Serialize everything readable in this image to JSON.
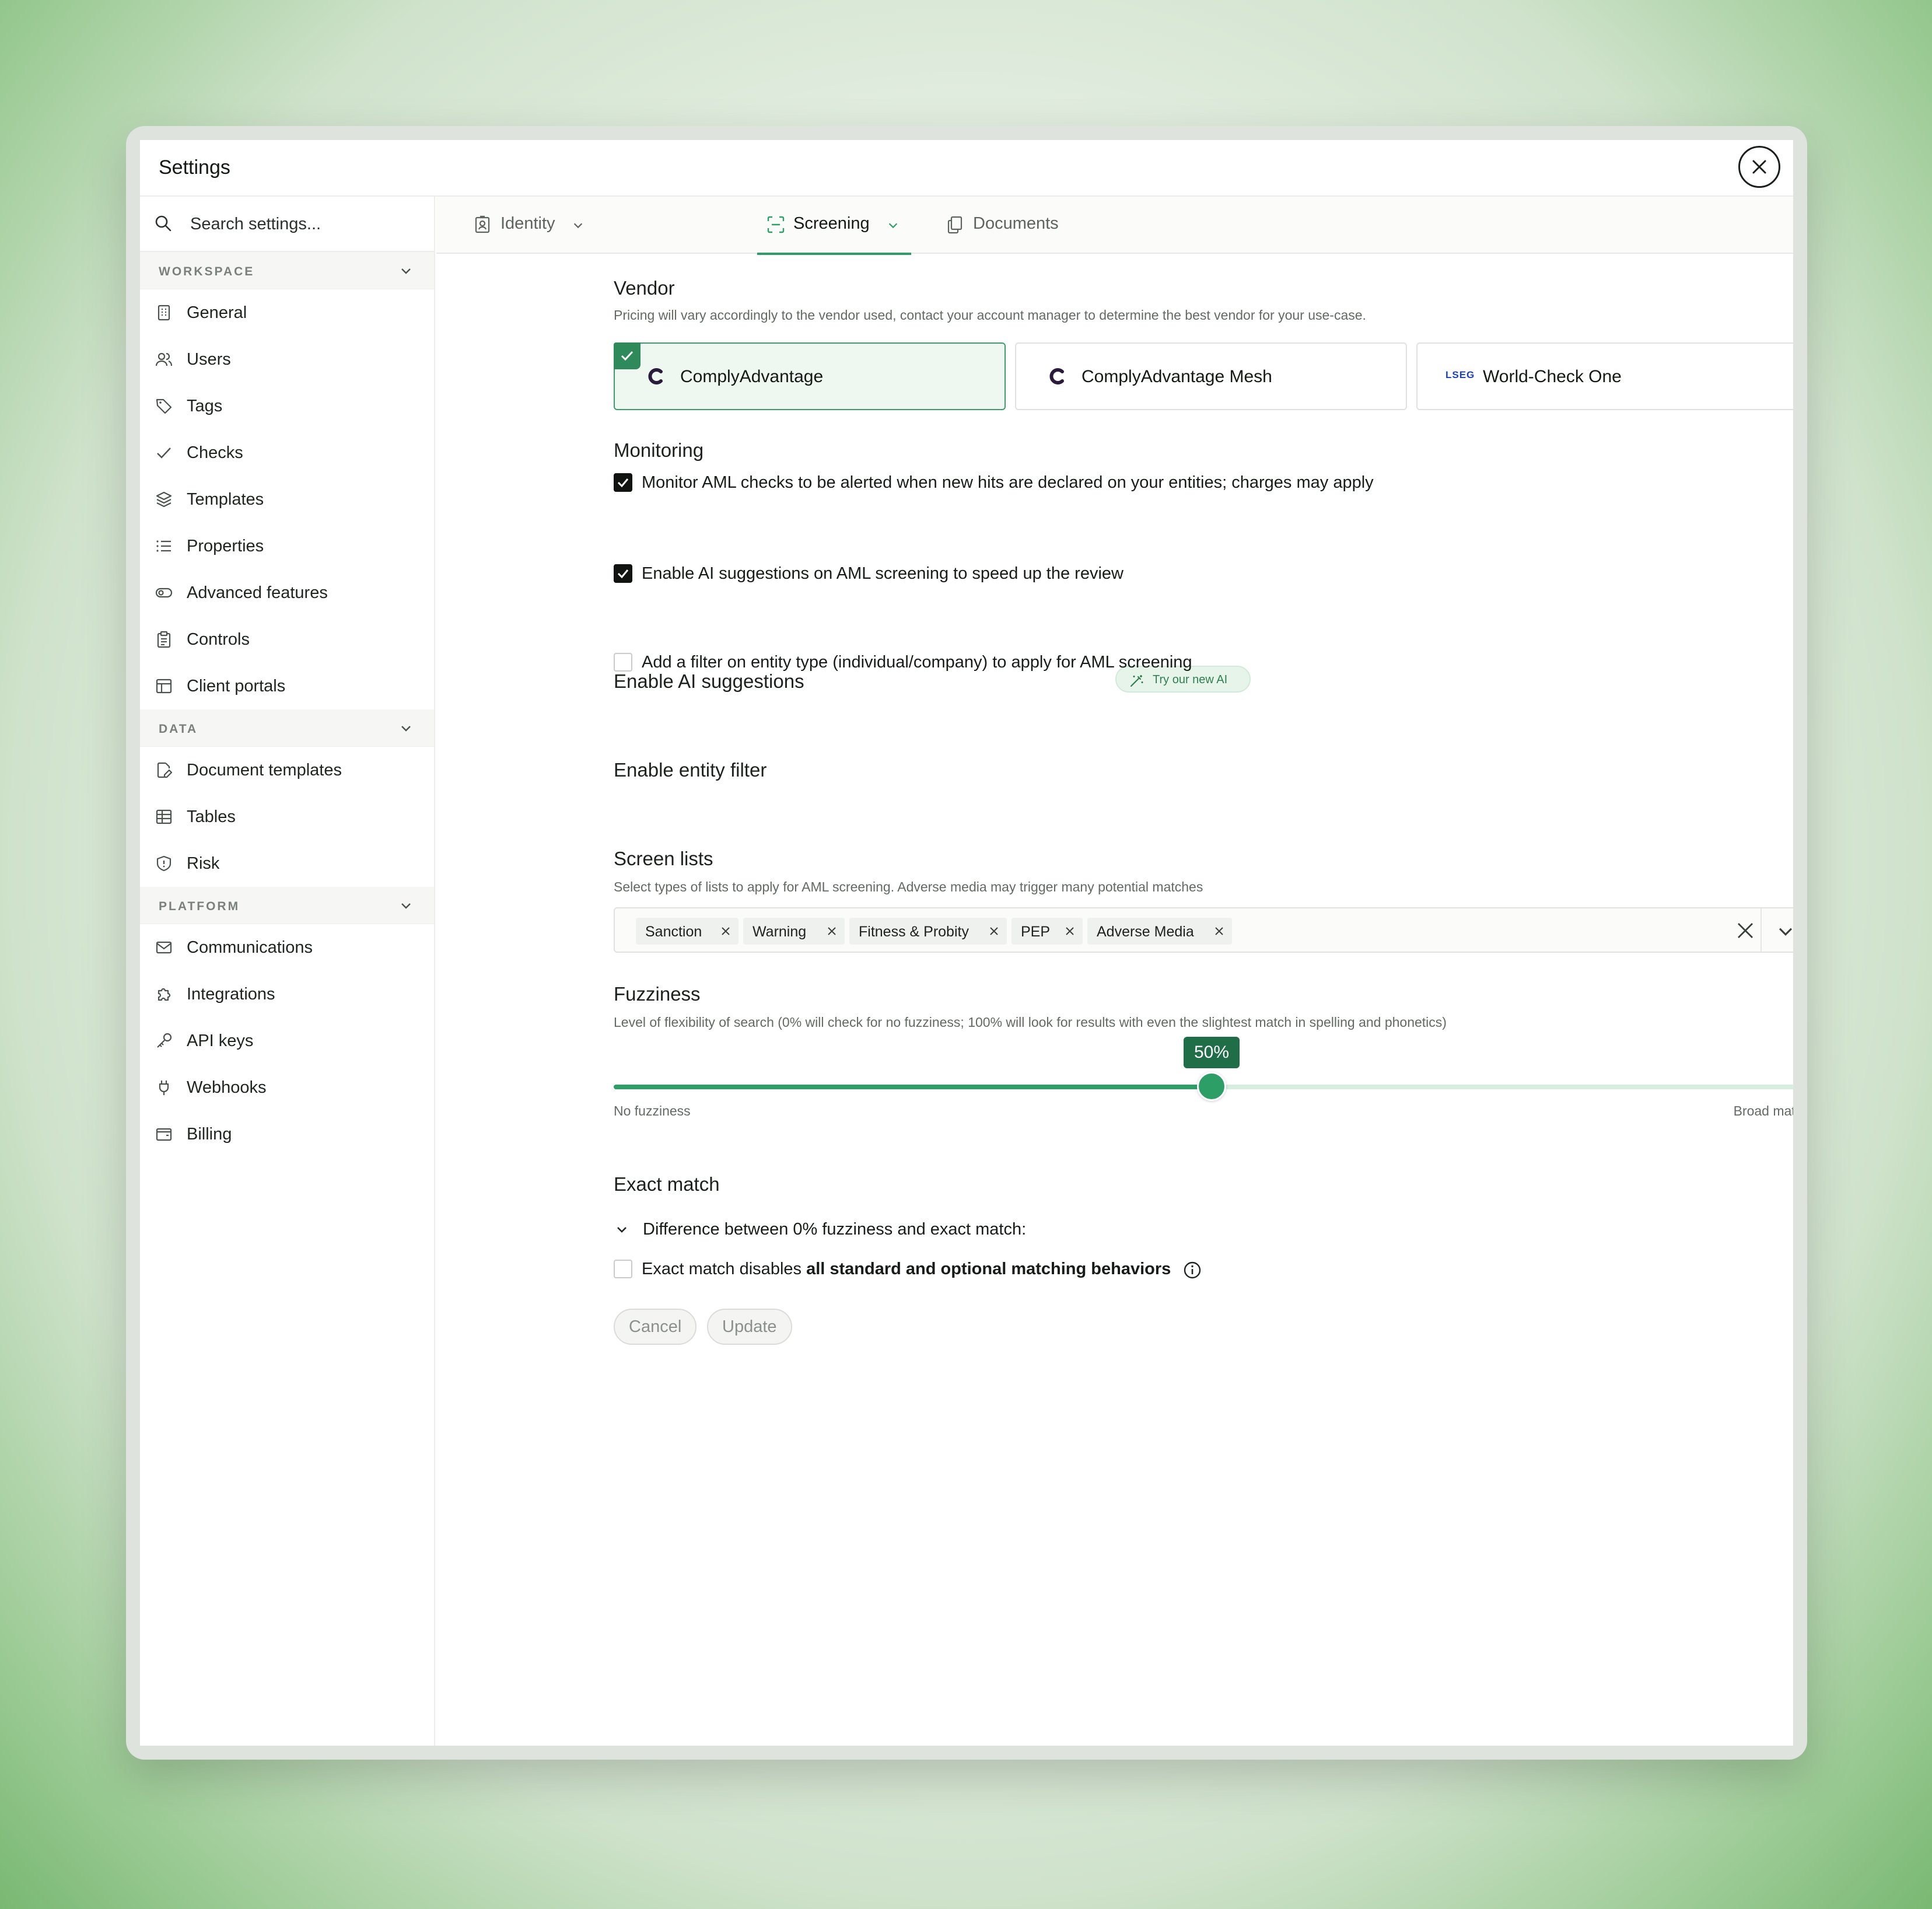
{
  "window": {
    "title": "Settings"
  },
  "search": {
    "placeholder": "Search settings..."
  },
  "sidebar": {
    "workspace": {
      "label": "WORKSPACE",
      "items": [
        {
          "label": "General",
          "icon": "building-icon"
        },
        {
          "label": "Users",
          "icon": "users-icon"
        },
        {
          "label": "Tags",
          "icon": "tag-icon"
        },
        {
          "label": "Checks",
          "icon": "check-icon"
        },
        {
          "label": "Templates",
          "icon": "layers-icon"
        },
        {
          "label": "Properties",
          "icon": "list-icon"
        },
        {
          "label": "Advanced features",
          "icon": "toggle-icon"
        },
        {
          "label": "Controls",
          "icon": "clipboard-icon"
        },
        {
          "label": "Client portals",
          "icon": "layout-icon"
        }
      ]
    },
    "data": {
      "label": "DATA",
      "items": [
        {
          "label": "Document templates",
          "icon": "file-edit-icon"
        },
        {
          "label": "Tables",
          "icon": "table-icon"
        },
        {
          "label": "Risk",
          "icon": "shield-icon"
        }
      ]
    },
    "platform": {
      "label": "PLATFORM",
      "items": [
        {
          "label": "Communications",
          "icon": "mail-icon"
        },
        {
          "label": "Integrations",
          "icon": "puzzle-icon"
        },
        {
          "label": "API keys",
          "icon": "key-icon"
        },
        {
          "label": "Webhooks",
          "icon": "plug-icon"
        },
        {
          "label": "Billing",
          "icon": "wallet-icon"
        }
      ]
    }
  },
  "tabs": [
    {
      "label": "Identity",
      "icon": "id-badge-icon",
      "active": false
    },
    {
      "label": "Screening",
      "icon": "scan-icon",
      "active": true
    },
    {
      "label": "Documents",
      "icon": "documents-icon",
      "active": false
    }
  ],
  "vendor": {
    "title": "Vendor",
    "description": "Pricing will vary accordingly to the vendor used, contact your account manager to determine the best vendor for your use-case.",
    "options": [
      {
        "name": "ComplyAdvantage",
        "selected": true
      },
      {
        "name": "ComplyAdvantage Mesh",
        "selected": false
      },
      {
        "name": "World-Check One",
        "logo_text": "LSEG",
        "selected": false
      }
    ]
  },
  "monitoring": {
    "title": "Monitoring",
    "checkbox_label": "Monitor AML checks to be alerted when new hits are declared on your entities; charges may apply",
    "checked": true
  },
  "ai": {
    "title": "Enable AI suggestions",
    "badge": "Try our new AI",
    "checkbox_label": "Enable AI suggestions on AML screening to speed up the review",
    "checked": true
  },
  "entity_filter": {
    "title": "Enable entity filter",
    "checkbox_label": "Add a filter on entity type (individual/company) to apply for AML screening",
    "checked": false
  },
  "screen_lists": {
    "title": "Screen lists",
    "description": "Select types of lists to apply for AML screening. Adverse media may trigger many potential matches",
    "chips": [
      "Sanction",
      "Warning",
      "Fitness & Probity",
      "PEP",
      "Adverse Media"
    ]
  },
  "fuzziness": {
    "title": "Fuzziness",
    "description": "Level of flexibility of search (0% will check for no fuzziness; 100% will look for results with even the slightest match in spelling and phonetics)",
    "value": 50,
    "value_label": "50%",
    "min_label": "No fuzziness",
    "max_label": "Broad match"
  },
  "exact_match": {
    "title": "Exact match",
    "disclosure": "Difference between 0% fuzziness and exact match:",
    "checkbox_label_prefix": "Exact match disables ",
    "checkbox_label_bold": "all standard and optional matching behaviors",
    "checked": false
  },
  "actions": {
    "cancel": "Cancel",
    "update": "Update"
  }
}
